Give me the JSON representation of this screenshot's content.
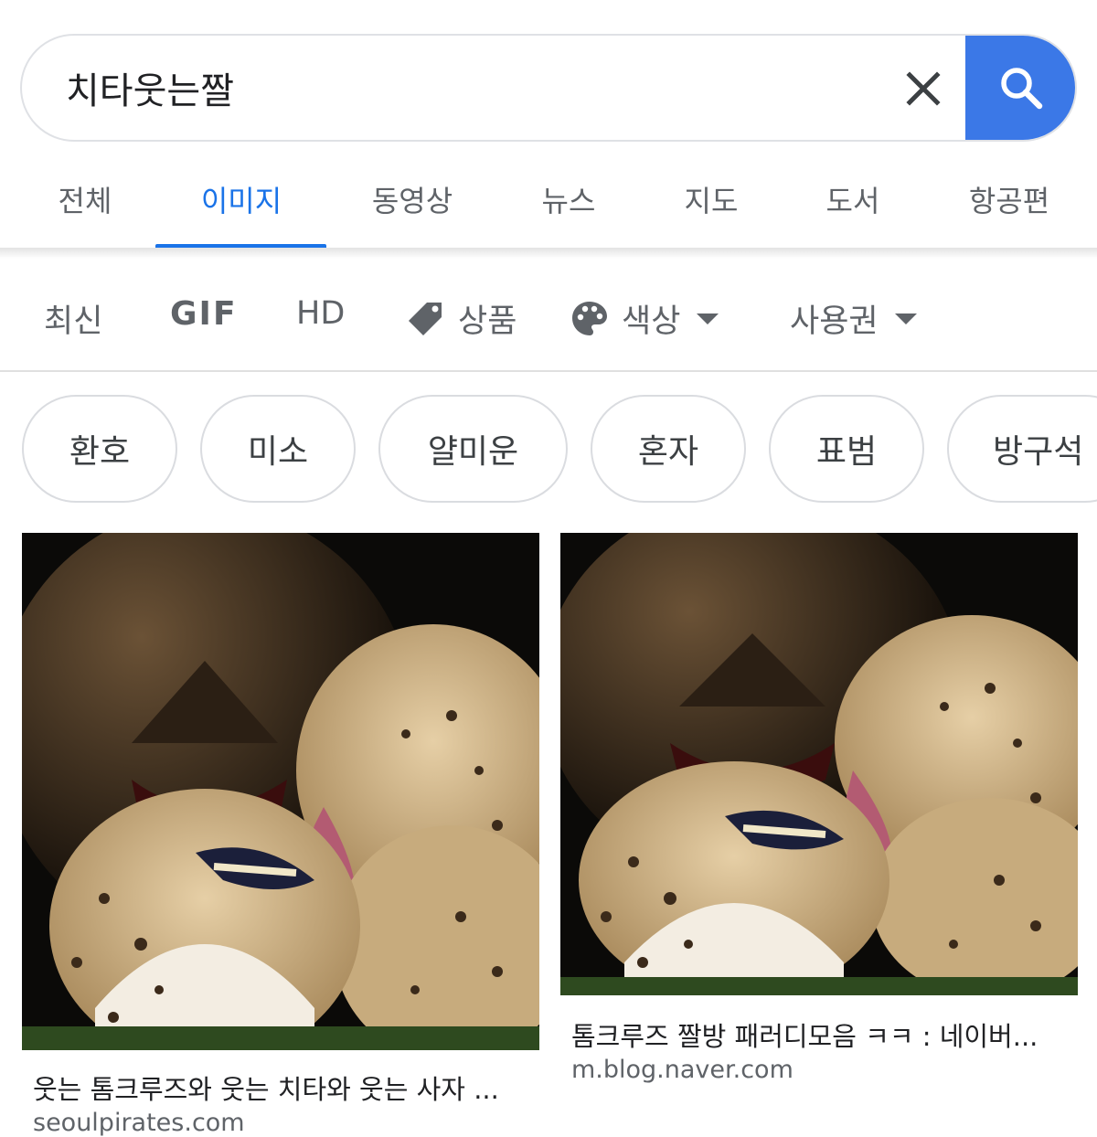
{
  "search": {
    "query": "치타웃는짤"
  },
  "tabs": [
    {
      "label": "전체"
    },
    {
      "label": "이미지"
    },
    {
      "label": "동영상"
    },
    {
      "label": "뉴스"
    },
    {
      "label": "지도"
    },
    {
      "label": "도서"
    },
    {
      "label": "항공편"
    }
  ],
  "active_tab": "이미지",
  "filters": {
    "recent": "최신",
    "gif": "GIF",
    "hd": "HD",
    "product": "상품",
    "color": "색상",
    "license": "사용권"
  },
  "chips": [
    "환호",
    "미소",
    "얄미운",
    "혼자",
    "표범",
    "방구석"
  ],
  "results": [
    {
      "caption": "웃는 톰크루즈와 웃는 치타와 웃는 사자 ...",
      "domain": "seoulpirates.com"
    },
    {
      "caption": "톰크루즈 짤방 패러디모음 ㅋㅋ : 네이버...",
      "domain": "m.blog.naver.com"
    }
  ],
  "colors": {
    "accent": "#1a73e8",
    "search_button": "#3b78e7",
    "border": "#dfe1e5"
  },
  "icons": {
    "clear": "close-icon",
    "search": "search-icon",
    "product": "tag-icon",
    "color": "palette-icon",
    "dropdown": "caret-down-icon"
  }
}
